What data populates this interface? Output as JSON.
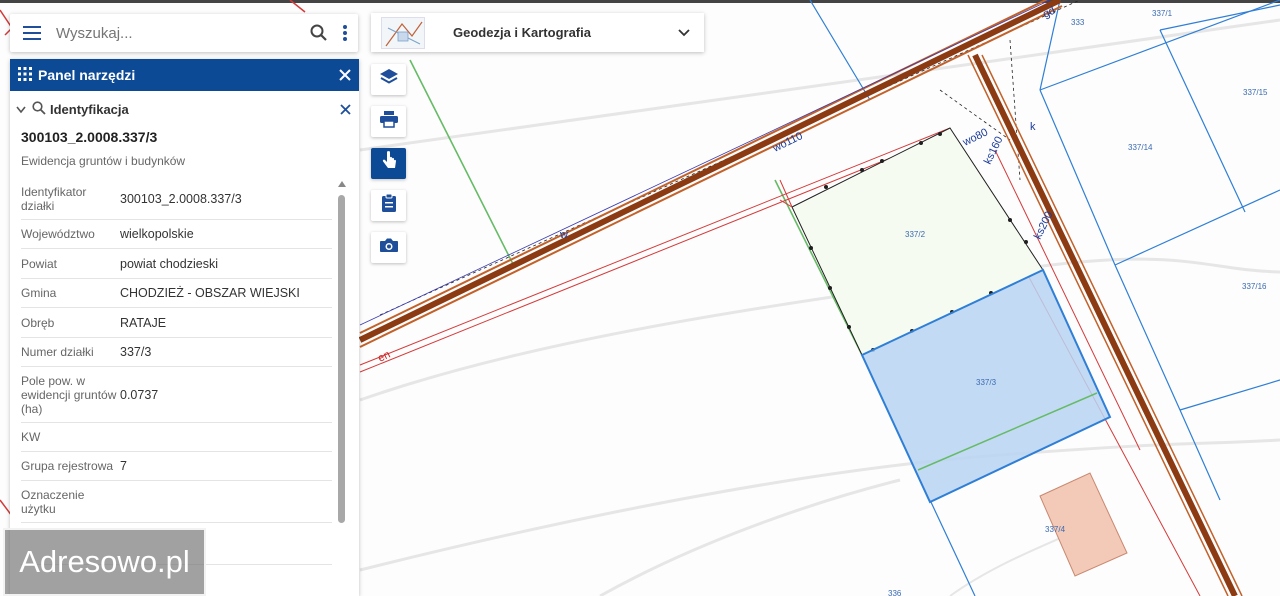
{
  "search": {
    "placeholder": "Wyszukaj..."
  },
  "panel": {
    "title": "Panel narzędzi",
    "identification": {
      "label": "Identyfikacja",
      "parcel_id": "300103_2.0008.337/3",
      "source": "Ewidencja gruntów i budynków",
      "attributes": [
        {
          "key": "Identyfikator działki",
          "value": "300103_2.0008.337/3"
        },
        {
          "key": "Województwo",
          "value": "wielkopolskie"
        },
        {
          "key": "Powiat",
          "value": "powiat chodzieski"
        },
        {
          "key": "Gmina",
          "value": "CHODZIEŻ - OBSZAR WIEJSKI"
        },
        {
          "key": "Obręb",
          "value": "RATAJE"
        },
        {
          "key": "Numer działki",
          "value": "337/3"
        },
        {
          "key": "Pole pow. w ewidencji gruntów (ha)",
          "value": "0.0737"
        },
        {
          "key": "KW",
          "value": ""
        },
        {
          "key": "Grupa rejestrowa",
          "value": "7"
        },
        {
          "key": "Oznaczenie użytku",
          "value": ""
        }
      ]
    }
  },
  "layer": {
    "title": "Geodezja i Kartografia"
  },
  "tools": [
    {
      "name": "layers-icon"
    },
    {
      "name": "print-icon"
    },
    {
      "name": "identify-icon",
      "active": true
    },
    {
      "name": "clipboard-icon"
    },
    {
      "name": "camera-icon"
    }
  ],
  "watermark": {
    "text": "Adresowo.pl"
  },
  "map": {
    "parcel_labels": [
      "337/1",
      "333",
      "337/15",
      "337/14",
      "337/2",
      "337/16",
      "337/3",
      "337/4",
      "336"
    ],
    "line_labels": [
      "wo110",
      "wo80",
      "ks160",
      "ks200",
      "en",
      "k",
      "w",
      "gd"
    ]
  },
  "colors": {
    "brand": "#0d4a96",
    "selected_parcel": "#b9d3f3",
    "road": "#8b3a12",
    "parcel_line": "#2f7fd6",
    "cable": "#d43a3a",
    "building": "#f3c9b7"
  }
}
